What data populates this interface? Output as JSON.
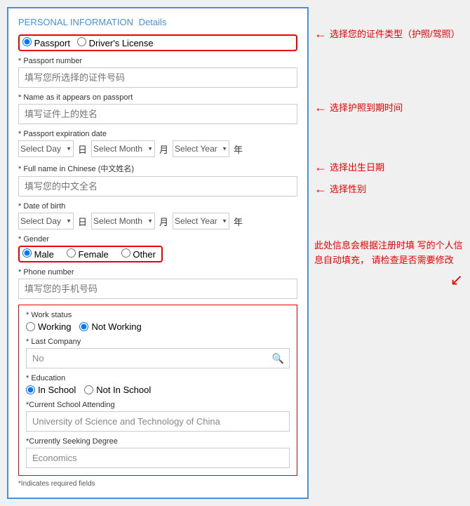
{
  "page": {
    "title": "PERSONAL INFORMATION",
    "title_link": "Details"
  },
  "id_type": {
    "label": "Passport",
    "label2": "Driver's License",
    "selected": "Passport"
  },
  "fields": {
    "passport_number": {
      "label": "* Passport number",
      "placeholder": "填写您所选择的证件号码"
    },
    "name_on_passport": {
      "label": "* Name as it appears on passport",
      "placeholder": "填写证件上的姓名"
    },
    "passport_expiry": {
      "label": "* Passport expiration date",
      "day_placeholder": "Select Day",
      "month_placeholder": "Select Month",
      "year_placeholder": "Select Year",
      "day_cn": "日",
      "month_cn": "月",
      "year_cn": "年"
    },
    "chinese_name": {
      "label": "* Full name in Chinese (中文姓名)",
      "placeholder": "填写您的中文全名"
    },
    "dob": {
      "label": "* Date of birth",
      "day_placeholder": "Select Day",
      "month_placeholder": "Select Month",
      "year_placeholder": "Select Year",
      "day_cn": "日",
      "month_cn": "月",
      "year_cn": "年"
    },
    "gender": {
      "label": "* Gender",
      "options": [
        "Male",
        "Female",
        "Other"
      ],
      "selected": "Male"
    },
    "phone": {
      "label": "* Phone number",
      "placeholder": "填写您的手机号码"
    },
    "work_status": {
      "label": "* Work status",
      "options": [
        "Working",
        "Not Working"
      ],
      "selected": "Not Working"
    },
    "last_company": {
      "label": "* Last Company",
      "value": "No"
    },
    "education": {
      "label": "* Education",
      "options": [
        "In School",
        "Not In School"
      ],
      "selected": "In School"
    },
    "current_school": {
      "label": "*Current School Attending",
      "value": "University of Science and Technology of China"
    },
    "degree": {
      "label": "*Currently Seeking Degree",
      "value": "Economics"
    }
  },
  "required_note": "*Indicates required fields",
  "annotations": {
    "id_type": "选择您的证件类型（护照/驾照）",
    "expiry": "选择护照到期时间",
    "dob": "选择出生日期",
    "gender": "选择性别",
    "auto_fill": "此处信息会根据注册时填\n写的个人信息自动填充，\n请检查是否需要修改"
  }
}
